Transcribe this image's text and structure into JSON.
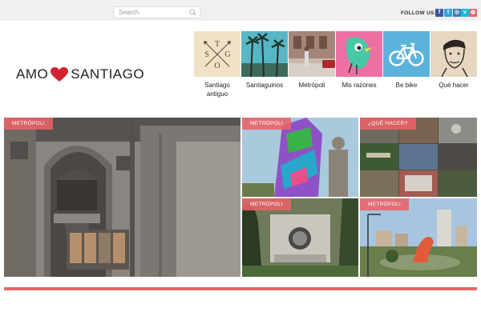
{
  "search": {
    "placeholder": "Search",
    "value": ""
  },
  "follow": {
    "label": "FOLLOW US:",
    "networks": [
      {
        "letter": "f",
        "color": "#3b5998",
        "icon": "facebook-icon"
      },
      {
        "letter": "t",
        "color": "#2fa6e0",
        "icon": "twitter-icon"
      },
      {
        "letter": "◎",
        "color": "#3b7bb0",
        "icon": "instagram-icon"
      },
      {
        "letter": "v",
        "color": "#1ab7ea",
        "icon": "vimeo-icon"
      },
      {
        "letter": "◍",
        "color": "#e8616b",
        "icon": "dribbble-icon"
      }
    ]
  },
  "logo": {
    "left": "AMO",
    "right": "SANTIAGO",
    "heart_color": "#d2232f"
  },
  "nav": [
    {
      "label": "Santiago antiguo",
      "icon": "compass-stgo-icon"
    },
    {
      "label": "Santiaguinos",
      "icon": "palm-trees-thumbnail"
    },
    {
      "label": "Metrópoli",
      "icon": "street-thumbnail"
    },
    {
      "label": "Mis razones",
      "icon": "bird-illustration-thumbnail"
    },
    {
      "label": "Be bike",
      "icon": "bicycle-icon"
    },
    {
      "label": "Qué hacer",
      "icon": "sketch-portrait-thumbnail"
    }
  ],
  "tiles": [
    {
      "badge": "METRÓPOLI"
    },
    {
      "badge": "METRÓPOLI"
    },
    {
      "badge": "¿QUÉ HACER?"
    },
    {
      "badge": "METRÓPOLI"
    },
    {
      "badge": "METRÓPOLI"
    }
  ],
  "colors": {
    "accent": "#e9686b",
    "topbar": "#f0f0f0"
  }
}
